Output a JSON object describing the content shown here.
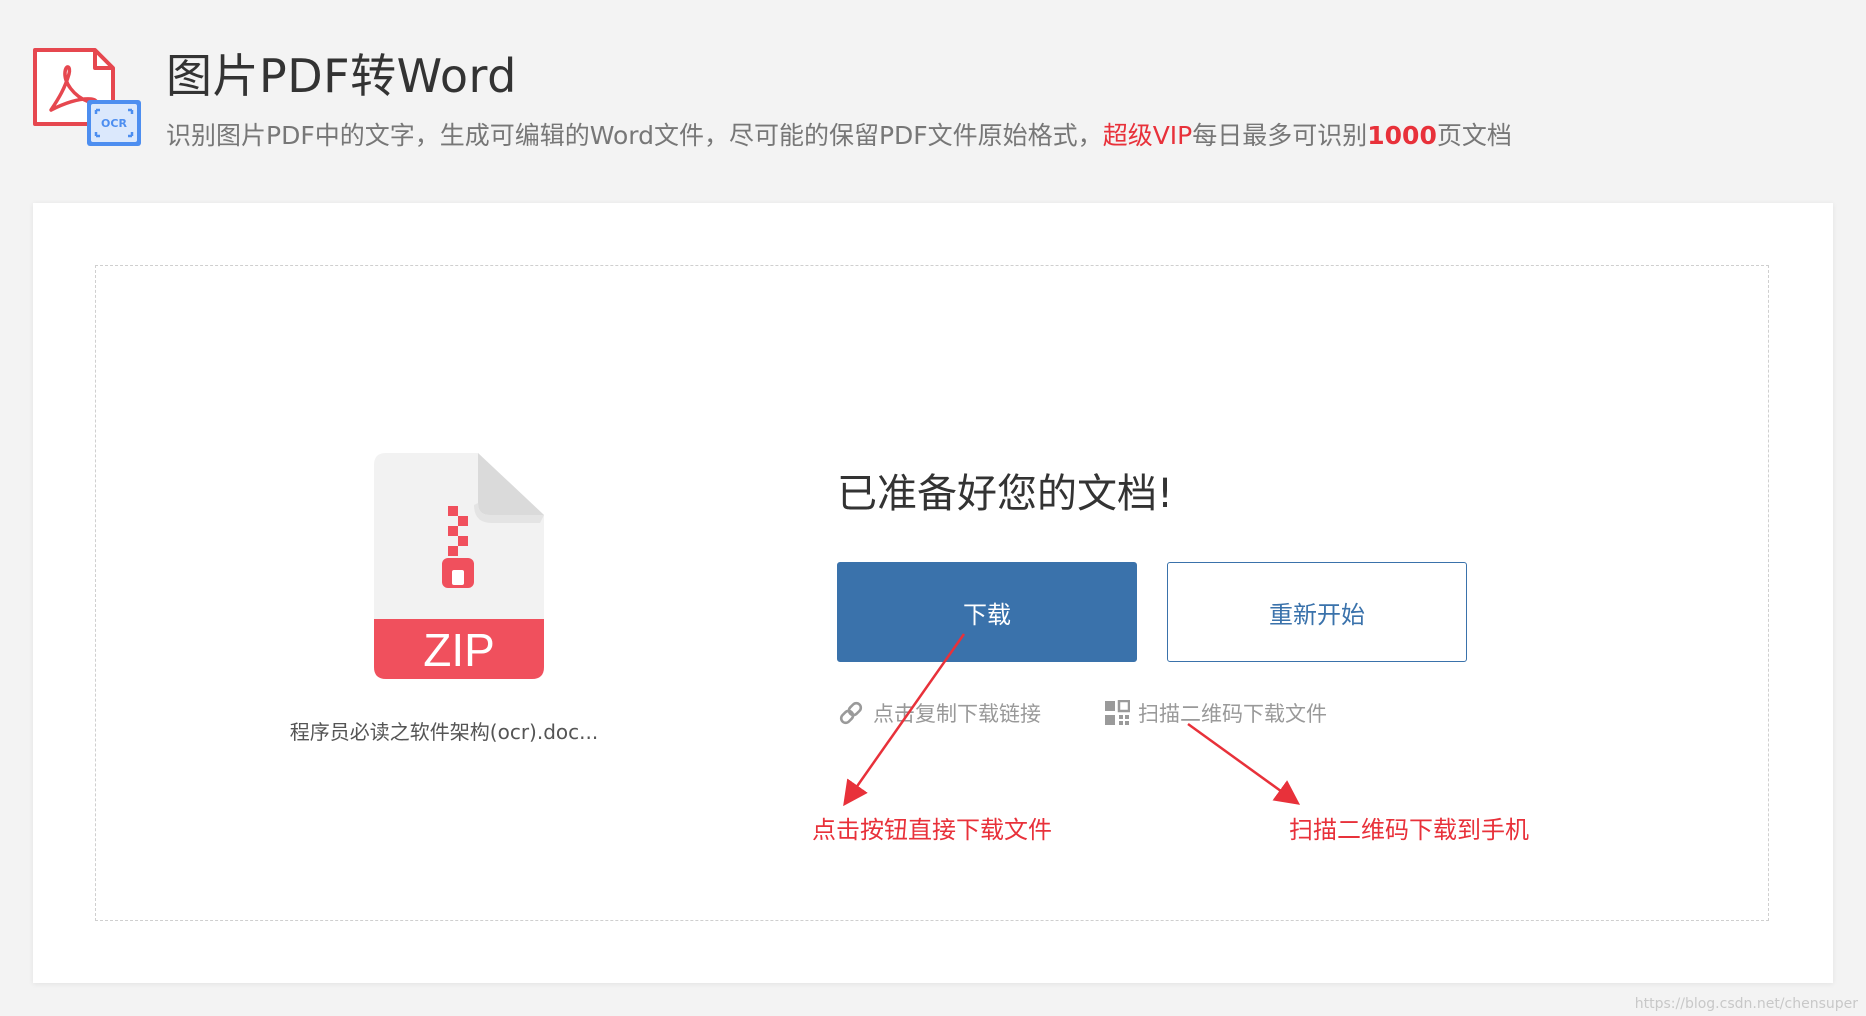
{
  "header": {
    "title": "图片PDF转Word",
    "subtitle_pre": "识别图片PDF中的文字，生成可编辑的Word文件，尽可能的保留PDF文件原始格式，",
    "subtitle_vip": "超级VIP",
    "subtitle_mid": "每日最多可识别",
    "subtitle_count": "1000",
    "subtitle_post": "页文档",
    "logo_badge": "OCR"
  },
  "file": {
    "type_label": "ZIP",
    "name": "程序员必读之软件架构(ocr).doc..."
  },
  "result": {
    "title": "已准备好您的文档!",
    "download_label": "下载",
    "restart_label": "重新开始",
    "copy_link_label": "点击复制下载链接",
    "qr_label": "扫描二维码下载文件"
  },
  "annotations": {
    "download_hint": "点击按钮直接下载文件",
    "qr_hint": "扫描二维码下载到手机"
  },
  "watermark": "https://blog.csdn.net/chensuper",
  "colors": {
    "accent": "#3a72ab",
    "annotation_red": "#e8313a",
    "zip_red": "#f0505d",
    "pdf_red": "#e6474f",
    "ocr_blue": "#4d8ef0"
  },
  "icons": {
    "logo": "pdf-ocr-logo-icon",
    "file": "zip-file-icon",
    "copy": "link-icon",
    "qr": "qr-code-icon"
  }
}
